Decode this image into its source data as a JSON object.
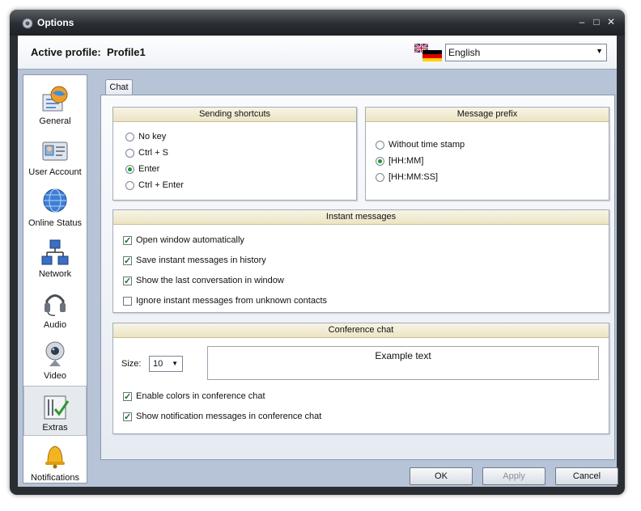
{
  "window": {
    "title": "Options"
  },
  "profile": {
    "label": "Active profile:",
    "name": "Profile1",
    "language": "English"
  },
  "sidebar": {
    "items": [
      {
        "label": "General",
        "icon": "globe-doc-icon"
      },
      {
        "label": "User Account",
        "icon": "id-card-icon"
      },
      {
        "label": "Online Status",
        "icon": "globe-icon"
      },
      {
        "label": "Network",
        "icon": "network-icon"
      },
      {
        "label": "Audio",
        "icon": "headset-icon"
      },
      {
        "label": "Video",
        "icon": "webcam-icon"
      },
      {
        "label": "Extras",
        "icon": "checklist-icon",
        "selected": true
      },
      {
        "label": "Notifications",
        "icon": "bell-icon"
      }
    ]
  },
  "tab": {
    "label": "Chat"
  },
  "sending_shortcuts": {
    "title": "Sending shortcuts",
    "options": [
      "No key",
      "Ctrl + S",
      "Enter",
      "Ctrl + Enter"
    ],
    "selected": "Enter"
  },
  "message_prefix": {
    "title": "Message prefix",
    "options": [
      "Without time stamp",
      "[HH:MM]",
      "[HH:MM:SS]"
    ],
    "selected": "[HH:MM]"
  },
  "instant_messages": {
    "title": "Instant messages",
    "options": [
      {
        "label": "Open window automatically",
        "checked": true
      },
      {
        "label": "Save instant messages in history",
        "checked": true
      },
      {
        "label": "Show the last conversation in window",
        "checked": true
      },
      {
        "label": "Ignore instant messages from unknown contacts",
        "checked": false
      }
    ]
  },
  "conference_chat": {
    "title": "Conference chat",
    "size_label": "Size:",
    "size_value": "10",
    "example_text": "Example text",
    "options": [
      {
        "label": "Enable colors in conference chat",
        "checked": true
      },
      {
        "label": "Show notification messages in conference chat",
        "checked": true
      }
    ]
  },
  "buttons": {
    "ok": "OK",
    "apply": "Apply",
    "cancel": "Cancel"
  },
  "colors": {
    "accent_green": "#1c9b2a",
    "client_bg": "#b7c3d6",
    "group_header": "#ece4c2"
  }
}
